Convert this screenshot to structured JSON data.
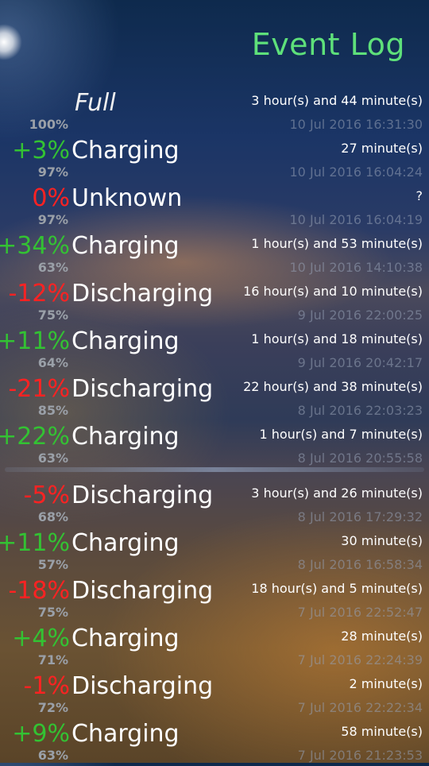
{
  "header": {
    "title": "Event Log"
  },
  "events": [
    {
      "delta": "",
      "sign": "none",
      "state": "Full",
      "level": "100%",
      "duration": "3 hour(s) and 44 minute(s)",
      "timestamp": "10 Jul 2016 16:31:30"
    },
    {
      "delta": "+3%",
      "sign": "pos",
      "state": "Charging",
      "level": "97%",
      "duration": "27 minute(s)",
      "timestamp": "10 Jul 2016 16:04:24"
    },
    {
      "delta": "0%",
      "sign": "neg",
      "state": "Unknown",
      "level": "97%",
      "duration": "?",
      "timestamp": "10 Jul 2016 16:04:19"
    },
    {
      "delta": "+34%",
      "sign": "pos",
      "state": "Charging",
      "level": "63%",
      "duration": "1 hour(s) and 53 minute(s)",
      "timestamp": "10 Jul 2016 14:10:38"
    },
    {
      "delta": "-12%",
      "sign": "neg",
      "state": "Discharging",
      "level": "75%",
      "duration": "16 hour(s) and 10 minute(s)",
      "timestamp": "9 Jul 2016 22:00:25"
    },
    {
      "delta": "+11%",
      "sign": "pos",
      "state": "Charging",
      "level": "64%",
      "duration": "1 hour(s) and 18 minute(s)",
      "timestamp": "9 Jul 2016 20:42:17"
    },
    {
      "delta": "-21%",
      "sign": "neg",
      "state": "Discharging",
      "level": "85%",
      "duration": "22 hour(s) and 38 minute(s)",
      "timestamp": "8 Jul 2016 22:03:23"
    },
    {
      "delta": "+22%",
      "sign": "pos",
      "state": "Charging",
      "level": "63%",
      "duration": "1 hour(s) and 7 minute(s)",
      "timestamp": "8 Jul 2016 20:55:58"
    },
    {
      "delta": "-5%",
      "sign": "neg",
      "state": "Discharging",
      "level": "68%",
      "duration": "3 hour(s) and 26 minute(s)",
      "timestamp": "8 Jul 2016 17:29:32"
    },
    {
      "delta": "+11%",
      "sign": "pos",
      "state": "Charging",
      "level": "57%",
      "duration": "30 minute(s)",
      "timestamp": "8 Jul 2016 16:58:34"
    },
    {
      "delta": "-18%",
      "sign": "neg",
      "state": "Discharging",
      "level": "75%",
      "duration": "18 hour(s) and 5 minute(s)",
      "timestamp": "7 Jul 2016 22:52:47"
    },
    {
      "delta": "+4%",
      "sign": "pos",
      "state": "Charging",
      "level": "71%",
      "duration": "28 minute(s)",
      "timestamp": "7 Jul 2016 22:24:39"
    },
    {
      "delta": "-1%",
      "sign": "neg",
      "state": "Discharging",
      "level": "72%",
      "duration": "2 minute(s)",
      "timestamp": "7 Jul 2016 22:22:34"
    },
    {
      "delta": "+9%",
      "sign": "pos",
      "state": "Charging",
      "level": "63%",
      "duration": "58 minute(s)",
      "timestamp": "7 Jul 2016 21:23:53"
    }
  ]
}
